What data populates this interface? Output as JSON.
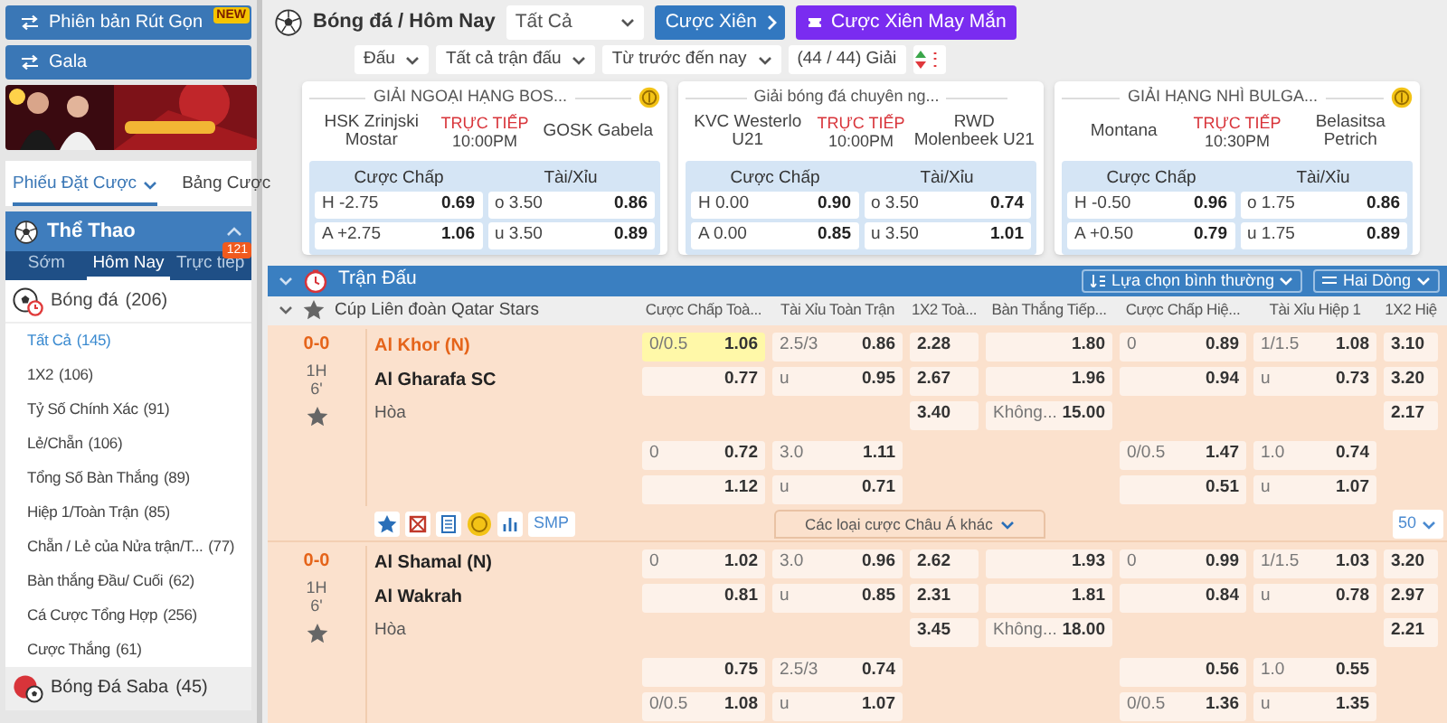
{
  "sidebar": {
    "buttons": [
      {
        "label": "Phiên bản Rút Gọn",
        "badge": "NEW"
      },
      {
        "label": "Gala"
      }
    ],
    "bet_tabs": [
      {
        "label": "Phiếu Đặt Cược",
        "selected": true
      },
      {
        "label": "Bảng Cược",
        "selected": false
      }
    ],
    "sport_header": {
      "title": "Thể Thao",
      "expanded": true
    },
    "time_tabs": [
      {
        "label": "Sớm",
        "selected": false
      },
      {
        "label": "Hôm Nay",
        "selected": true
      },
      {
        "label": "Trực tiếp",
        "selected": false,
        "badge": "121"
      }
    ],
    "sports": [
      {
        "label": "Bóng đá",
        "count": "(206)",
        "kind": "soccer",
        "selected": false,
        "children": [
          {
            "label": "Tất Cả",
            "count": "(145)",
            "selected": true
          },
          {
            "label": "1X2",
            "count": "(106)",
            "selected": false
          },
          {
            "label": "Tỷ Số Chính Xác",
            "count": "(91)",
            "selected": false
          },
          {
            "label": "Lẻ/Chẵn",
            "count": "(106)",
            "selected": false
          },
          {
            "label": "Tổng Số Bàn Thắng",
            "count": "(89)",
            "selected": false
          },
          {
            "label": "Hiệp 1/Toàn Trận",
            "count": "(85)",
            "selected": false
          },
          {
            "label": "Chẵn / Lẻ của Nửa trận/T...",
            "count": "(77)",
            "selected": false
          },
          {
            "label": "Bàn thắng Đầu/ Cuối",
            "count": "(62)",
            "selected": false
          },
          {
            "label": "Cá Cược Tổng Hợp",
            "count": "(256)",
            "selected": false
          },
          {
            "label": "Cược Thắng",
            "count": "(61)",
            "selected": false
          }
        ]
      },
      {
        "label": "Bóng Đá Saba",
        "count": "(45)",
        "kind": "saba",
        "selected": true
      }
    ]
  },
  "toolbar": {
    "breadcrumb": "Bóng đá / Hôm Nay",
    "filter": "Tất Cả",
    "buttons": [
      {
        "label": "Cược Xiên",
        "kind": "parlay"
      },
      {
        "label": "Cược Xiên May Mắn",
        "kind": "lucky"
      }
    ]
  },
  "filters": [
    {
      "label": "Đấu",
      "kind": "dropdown"
    },
    {
      "label": "Tất cả trận đấu",
      "kind": "dropdown"
    },
    {
      "label": "Từ trước đến nay",
      "kind": "dropdown"
    },
    {
      "label": "(44 / 44) Giải",
      "kind": "count"
    }
  ],
  "featured": [
    {
      "league": "GIẢI NGOẠI HẠNG BOS...",
      "coin": true,
      "home": "HSK Zrinjski Mostar",
      "status": "TRỰC TIẾP",
      "time": "10:00PM",
      "away": "GOSK Gabela",
      "headers": [
        "Cược Chấp",
        "Tài/Xỉu"
      ],
      "rows": [
        [
          {
            "pick": "H -2.75",
            "odds": "0.69"
          },
          {
            "pick": "o 3.50",
            "odds": "0.86"
          }
        ],
        [
          {
            "pick": "A +2.75",
            "odds": "1.06"
          },
          {
            "pick": "u 3.50",
            "odds": "0.89"
          }
        ]
      ]
    },
    {
      "league": "Giải bóng đá chuyên ng...",
      "coin": false,
      "home": "KVC Westerlo U21",
      "status": "TRỰC TIẾP",
      "time": "10:00PM",
      "away": "RWD Molenbeek U21",
      "headers": [
        "Cược Chấp",
        "Tài/Xỉu"
      ],
      "rows": [
        [
          {
            "pick": "H 0.00",
            "odds": "0.90"
          },
          {
            "pick": "o 3.50",
            "odds": "0.74"
          }
        ],
        [
          {
            "pick": "A 0.00",
            "odds": "0.85"
          },
          {
            "pick": "u 3.50",
            "odds": "1.01"
          }
        ]
      ]
    },
    {
      "league": "GIẢI HẠNG NHÌ BULGA...",
      "coin": true,
      "home": "Montana",
      "status": "TRỰC TIẾP",
      "time": "10:30PM",
      "away": "Belasitsa Petrich",
      "headers": [
        "Cược Chấp",
        "Tài/Xỉu"
      ],
      "rows": [
        [
          {
            "pick": "H -0.50",
            "odds": "0.96"
          },
          {
            "pick": "o 1.75",
            "odds": "0.86"
          }
        ],
        [
          {
            "pick": "A +0.50",
            "odds": "0.79"
          },
          {
            "pick": "u 1.75",
            "odds": "0.89"
          }
        ]
      ]
    }
  ],
  "match_panel": {
    "title": "Trận Đấu",
    "expanded": true,
    "options": [
      "Lựa chọn bình thường",
      "Hai Dòng"
    ],
    "league": "Cúp Liên đoàn Qatar Stars",
    "columns": [
      {
        "label": "Cược Chấp Toà...",
        "kind": "line"
      },
      {
        "label": "Tài Xỉu Toàn Trận",
        "kind": "line"
      },
      {
        "label": "1X2 Toà...",
        "kind": "price"
      },
      {
        "label": "Bàn Thắng Tiếp...",
        "kind": "line"
      },
      {
        "label": "Cược Chấp Hiệ...",
        "kind": "line"
      },
      {
        "label": "Tài Xỉu Hiệp 1",
        "kind": "line"
      },
      {
        "label": "1X2 Hiệ",
        "kind": "price"
      }
    ],
    "matches": [
      {
        "score": "0-0",
        "period": "1H",
        "minute": "6'",
        "favorite": false,
        "home": "Al Khor (N)",
        "home_highlighted": true,
        "away": "Al Gharafa SC",
        "draw": "Hòa",
        "rows": [
          [
            {
              "line": "0/0.5",
              "odds": "1.06",
              "highlighted": true
            },
            {
              "line": "2.5/3",
              "odds": "0.86",
              "highlighted": false
            },
            {
              "odds": "2.28",
              "highlighted": false
            },
            {
              "odds": "1.80",
              "highlighted": false
            },
            {
              "line": "0",
              "odds": "0.89",
              "highlighted": false
            },
            {
              "line": "1/1.5",
              "odds": "1.08",
              "highlighted": false
            },
            {
              "odds": "3.10",
              "highlighted": false
            }
          ],
          [
            {
              "odds": "0.77",
              "highlighted": false
            },
            {
              "line": "u",
              "odds": "0.95",
              "highlighted": false
            },
            {
              "odds": "2.67",
              "highlighted": false
            },
            {
              "odds": "1.96",
              "highlighted": false
            },
            {
              "odds": "0.94",
              "highlighted": false
            },
            {
              "line": "u",
              "odds": "0.73",
              "highlighted": false
            },
            {
              "odds": "3.20",
              "highlighted": false
            }
          ],
          [
            null,
            null,
            {
              "odds": "3.40",
              "highlighted": false
            },
            {
              "line": "Không...",
              "odds": "15.00",
              "highlighted": false
            },
            null,
            null,
            {
              "odds": "2.17",
              "highlighted": false
            }
          ],
          [
            {
              "line": "0",
              "odds": "0.72",
              "highlighted": false
            },
            {
              "line": "3.0",
              "odds": "1.11",
              "highlighted": false
            },
            null,
            null,
            {
              "line": "0/0.5",
              "odds": "1.47",
              "highlighted": false
            },
            {
              "line": "1.0",
              "odds": "0.74",
              "highlighted": false
            },
            null
          ],
          [
            {
              "odds": "1.12",
              "highlighted": false
            },
            {
              "line": "u",
              "odds": "0.71",
              "highlighted": false
            },
            null,
            null,
            {
              "odds": "0.51",
              "highlighted": false
            },
            {
              "line": "u",
              "odds": "1.07",
              "highlighted": false
            },
            null
          ]
        ],
        "footer": {
          "smp": "SMP",
          "more_bets": "Các loại cược Châu Á khác",
          "page_size": "50"
        }
      },
      {
        "score": "0-0",
        "period": "1H",
        "minute": "6'",
        "favorite": false,
        "home": "Al Shamal (N)",
        "home_highlighted": false,
        "away": "Al Wakrah",
        "draw": "Hòa",
        "rows": [
          [
            {
              "line": "0",
              "odds": "1.02",
              "highlighted": false
            },
            {
              "line": "3.0",
              "odds": "0.96",
              "highlighted": false
            },
            {
              "odds": "2.62",
              "highlighted": false
            },
            {
              "odds": "1.93",
              "highlighted": false
            },
            {
              "line": "0",
              "odds": "0.99",
              "highlighted": false
            },
            {
              "line": "1/1.5",
              "odds": "1.03",
              "highlighted": false
            },
            {
              "odds": "3.20",
              "highlighted": false
            }
          ],
          [
            {
              "odds": "0.81",
              "highlighted": false
            },
            {
              "line": "u",
              "odds": "0.85",
              "highlighted": false
            },
            {
              "odds": "2.31",
              "highlighted": false
            },
            {
              "odds": "1.81",
              "highlighted": false
            },
            {
              "odds": "0.84",
              "highlighted": false
            },
            {
              "line": "u",
              "odds": "0.78",
              "highlighted": false
            },
            {
              "odds": "2.97",
              "highlighted": false
            }
          ],
          [
            null,
            null,
            {
              "odds": "3.45",
              "highlighted": false
            },
            {
              "line": "Không...",
              "odds": "18.00",
              "highlighted": false
            },
            null,
            null,
            {
              "odds": "2.21",
              "highlighted": false
            }
          ],
          [
            {
              "odds": "0.75",
              "highlighted": false
            },
            {
              "line": "2.5/3",
              "odds": "0.74",
              "highlighted": false
            },
            null,
            null,
            {
              "odds": "0.56",
              "highlighted": false
            },
            {
              "line": "1.0",
              "odds": "0.55",
              "highlighted": false
            },
            null
          ],
          [
            {
              "line": "0/0.5",
              "odds": "1.08",
              "highlighted": false
            },
            {
              "line": "u",
              "odds": "1.07",
              "highlighted": false
            },
            null,
            null,
            {
              "line": "0/0.5",
              "odds": "1.36",
              "highlighted": false
            },
            {
              "line": "u",
              "odds": "1.35",
              "highlighted": false
            },
            null
          ]
        ]
      }
    ]
  }
}
